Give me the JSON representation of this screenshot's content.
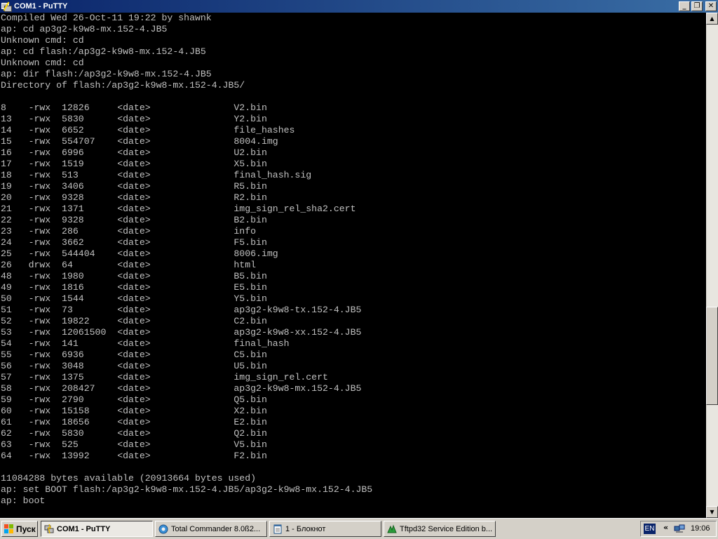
{
  "window": {
    "title": "COM1 - PuTTY",
    "minimize_glyph": "_",
    "maximize_glyph": "❐",
    "close_glyph": "✕"
  },
  "terminal": {
    "lines": [
      "Compiled Wed 26-Oct-11 19:22 by shawnk",
      "ap: cd ap3g2-k9w8-mx.152-4.JB5",
      "Unknown cmd: cd",
      "ap: cd flash:/ap3g2-k9w8-mx.152-4.JB5",
      "Unknown cmd: cd",
      "ap: dir flash:/ap3g2-k9w8-mx.152-4.JB5",
      "Directory of flash:/ap3g2-k9w8-mx.152-4.JB5/",
      "",
      "8    -rwx  12826     <date>               V2.bin",
      "13   -rwx  5830      <date>               Y2.bin",
      "14   -rwx  6652      <date>               file_hashes",
      "15   -rwx  554707    <date>               8004.img",
      "16   -rwx  6996      <date>               U2.bin",
      "17   -rwx  1519      <date>               X5.bin",
      "18   -rwx  513       <date>               final_hash.sig",
      "19   -rwx  3406      <date>               R5.bin",
      "20   -rwx  9328      <date>               R2.bin",
      "21   -rwx  1371      <date>               img_sign_rel_sha2.cert",
      "22   -rwx  9328      <date>               B2.bin",
      "23   -rwx  286       <date>               info",
      "24   -rwx  3662      <date>               F5.bin",
      "25   -rwx  544404    <date>               8006.img",
      "26   drwx  64        <date>               html",
      "48   -rwx  1980      <date>               B5.bin",
      "49   -rwx  1816      <date>               E5.bin",
      "50   -rwx  1544      <date>               Y5.bin",
      "51   -rwx  73        <date>               ap3g2-k9w8-tx.152-4.JB5",
      "52   -rwx  19822     <date>               C2.bin",
      "53   -rwx  12061500  <date>               ap3g2-k9w8-xx.152-4.JB5",
      "54   -rwx  141       <date>               final_hash",
      "55   -rwx  6936      <date>               C5.bin",
      "56   -rwx  3048      <date>               U5.bin",
      "57   -rwx  1375      <date>               img_sign_rel.cert",
      "58   -rwx  208427    <date>               ap3g2-k9w8-mx.152-4.JB5",
      "59   -rwx  2790      <date>               Q5.bin",
      "60   -rwx  15158     <date>               X2.bin",
      "61   -rwx  18656     <date>               E2.bin",
      "62   -rwx  5830      <date>               Q2.bin",
      "63   -rwx  525       <date>               V5.bin",
      "64   -rwx  13992     <date>               F2.bin",
      "",
      "11084288 bytes available (20913664 bytes used)",
      "ap: set BOOT flash:/ap3g2-k9w8-mx.152-4.JB5/ap3g2-k9w8-mx.152-4.JB5",
      "ap: boot"
    ]
  },
  "scrollbar": {
    "up_glyph": "▲",
    "down_glyph": "▼"
  },
  "taskbar": {
    "start_label": "Пуск",
    "tasks": [
      {
        "label": "COM1 - PuTTY",
        "active": true
      },
      {
        "label": "Total Commander 8.0ß2...",
        "active": false
      },
      {
        "label": "1 - Блокнот",
        "active": false
      },
      {
        "label": "Tftpd32 Service Edition b...",
        "active": false
      }
    ],
    "tray": {
      "language": "EN",
      "expand_glyph": "«",
      "clock": "19:06"
    }
  },
  "colors": {
    "terminal_bg": "#000000",
    "terminal_fg": "#c0c0c0",
    "titlebar_start": "#0a246a",
    "titlebar_end": "#3a6ea5",
    "chrome": "#d4d0c8"
  }
}
